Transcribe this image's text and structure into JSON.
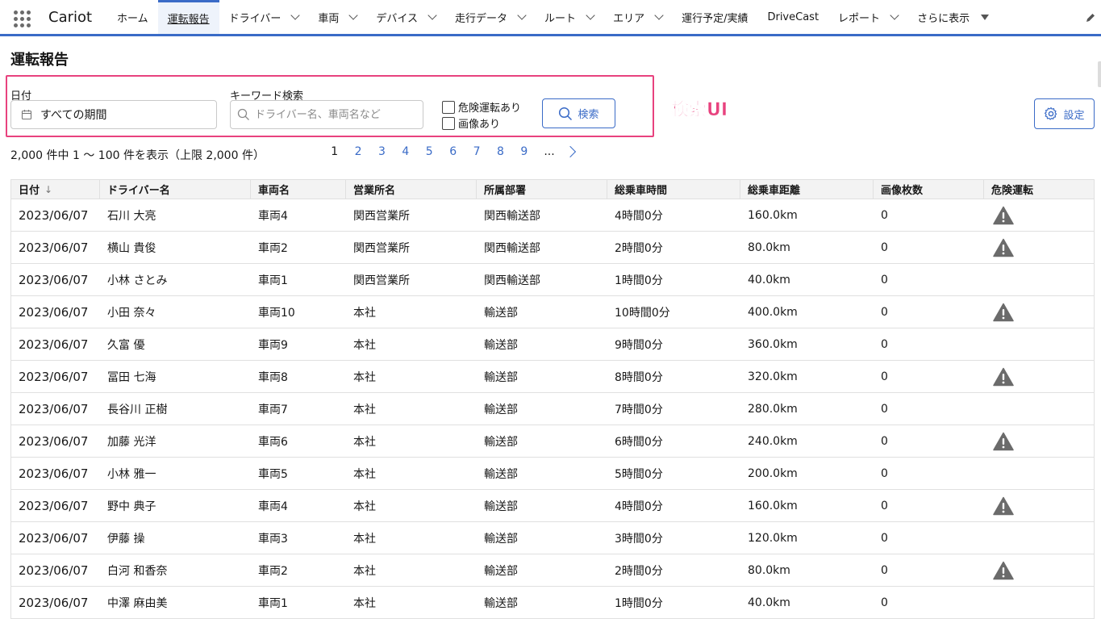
{
  "app": {
    "name": "Cariot"
  },
  "nav": {
    "tabs": [
      {
        "label": "ホーム",
        "has_menu": false,
        "active": false
      },
      {
        "label": "運転報告",
        "has_menu": false,
        "active": true
      },
      {
        "label": "ドライバー",
        "has_menu": true,
        "active": false
      },
      {
        "label": "車両",
        "has_menu": true,
        "active": false
      },
      {
        "label": "デバイス",
        "has_menu": true,
        "active": false
      },
      {
        "label": "走行データ",
        "has_menu": true,
        "active": false
      },
      {
        "label": "ルート",
        "has_menu": true,
        "active": false
      },
      {
        "label": "エリア",
        "has_menu": true,
        "active": false
      },
      {
        "label": "運行予定/実績",
        "has_menu": false,
        "active": false
      },
      {
        "label": "DriveCast",
        "has_menu": false,
        "active": false
      },
      {
        "label": "レポート",
        "has_menu": true,
        "active": false
      },
      {
        "label": "さらに表示",
        "has_menu": "more",
        "active": false
      }
    ],
    "edit_icon": "pencil-icon",
    "accent": "#3a6bc7"
  },
  "page": {
    "title": "運転報告"
  },
  "search": {
    "date_label": "日付",
    "date_value": "すべての期間",
    "keyword_label": "キーワード検索",
    "keyword_placeholder": "ドライバー名、車両名など",
    "keyword_value": "",
    "check_danger_label": "危険運転あり",
    "check_image_label": "画像あり",
    "check_danger_checked": false,
    "check_image_checked": false,
    "button_label": "検索",
    "annotation_label": "検索UI",
    "annotation_color": "#e8427e"
  },
  "settings": {
    "button_label": "設定"
  },
  "results": {
    "count_text": "2,000 件中 1 〜 100 件を表示（上限 2,000 件）",
    "pages": [
      "1",
      "2",
      "3",
      "4",
      "5",
      "6",
      "7",
      "8",
      "9"
    ],
    "current_page": "1",
    "ellipsis": "..."
  },
  "table": {
    "columns": [
      "日付",
      "ドライバー名",
      "車両名",
      "営業所名",
      "所属部署",
      "総乗車時間",
      "総乗車距離",
      "画像枚数",
      "危険運転"
    ],
    "sort_indicator": "↓",
    "rows": [
      {
        "date": "2023/06/07",
        "driver": "石川 大亮",
        "vehicle": "車両4",
        "office": "関西営業所",
        "dept": "関西輸送部",
        "time": "4時間0分",
        "distance": "160.0km",
        "images": "0",
        "danger": true
      },
      {
        "date": "2023/06/07",
        "driver": "横山 貴俊",
        "vehicle": "車両2",
        "office": "関西営業所",
        "dept": "関西輸送部",
        "time": "2時間0分",
        "distance": "80.0km",
        "images": "0",
        "danger": true
      },
      {
        "date": "2023/06/07",
        "driver": "小林 さとみ",
        "vehicle": "車両1",
        "office": "関西営業所",
        "dept": "関西輸送部",
        "time": "1時間0分",
        "distance": "40.0km",
        "images": "0",
        "danger": false
      },
      {
        "date": "2023/06/07",
        "driver": "小田 奈々",
        "vehicle": "車両10",
        "office": "本社",
        "dept": "輸送部",
        "time": "10時間0分",
        "distance": "400.0km",
        "images": "0",
        "danger": true
      },
      {
        "date": "2023/06/07",
        "driver": "久富 優",
        "vehicle": "車両9",
        "office": "本社",
        "dept": "輸送部",
        "time": "9時間0分",
        "distance": "360.0km",
        "images": "0",
        "danger": false
      },
      {
        "date": "2023/06/07",
        "driver": "冨田 七海",
        "vehicle": "車両8",
        "office": "本社",
        "dept": "輸送部",
        "time": "8時間0分",
        "distance": "320.0km",
        "images": "0",
        "danger": true
      },
      {
        "date": "2023/06/07",
        "driver": "長谷川 正樹",
        "vehicle": "車両7",
        "office": "本社",
        "dept": "輸送部",
        "time": "7時間0分",
        "distance": "280.0km",
        "images": "0",
        "danger": false
      },
      {
        "date": "2023/06/07",
        "driver": "加藤 光洋",
        "vehicle": "車両6",
        "office": "本社",
        "dept": "輸送部",
        "time": "6時間0分",
        "distance": "240.0km",
        "images": "0",
        "danger": true
      },
      {
        "date": "2023/06/07",
        "driver": "小林 雅一",
        "vehicle": "車両5",
        "office": "本社",
        "dept": "輸送部",
        "time": "5時間0分",
        "distance": "200.0km",
        "images": "0",
        "danger": false
      },
      {
        "date": "2023/06/07",
        "driver": "野中 典子",
        "vehicle": "車両4",
        "office": "本社",
        "dept": "輸送部",
        "time": "4時間0分",
        "distance": "160.0km",
        "images": "0",
        "danger": true
      },
      {
        "date": "2023/06/07",
        "driver": "伊藤 操",
        "vehicle": "車両3",
        "office": "本社",
        "dept": "輸送部",
        "time": "3時間0分",
        "distance": "120.0km",
        "images": "0",
        "danger": false
      },
      {
        "date": "2023/06/07",
        "driver": "白河 和香奈",
        "vehicle": "車両2",
        "office": "本社",
        "dept": "輸送部",
        "time": "2時間0分",
        "distance": "80.0km",
        "images": "0",
        "danger": true
      },
      {
        "date": "2023/06/07",
        "driver": "中澤 麻由美",
        "vehicle": "車両1",
        "office": "本社",
        "dept": "輸送部",
        "time": "1時間0分",
        "distance": "40.0km",
        "images": "0",
        "danger": false
      }
    ],
    "danger_icon": "warning-triangle-icon",
    "danger_color": "#6b6b6b"
  }
}
